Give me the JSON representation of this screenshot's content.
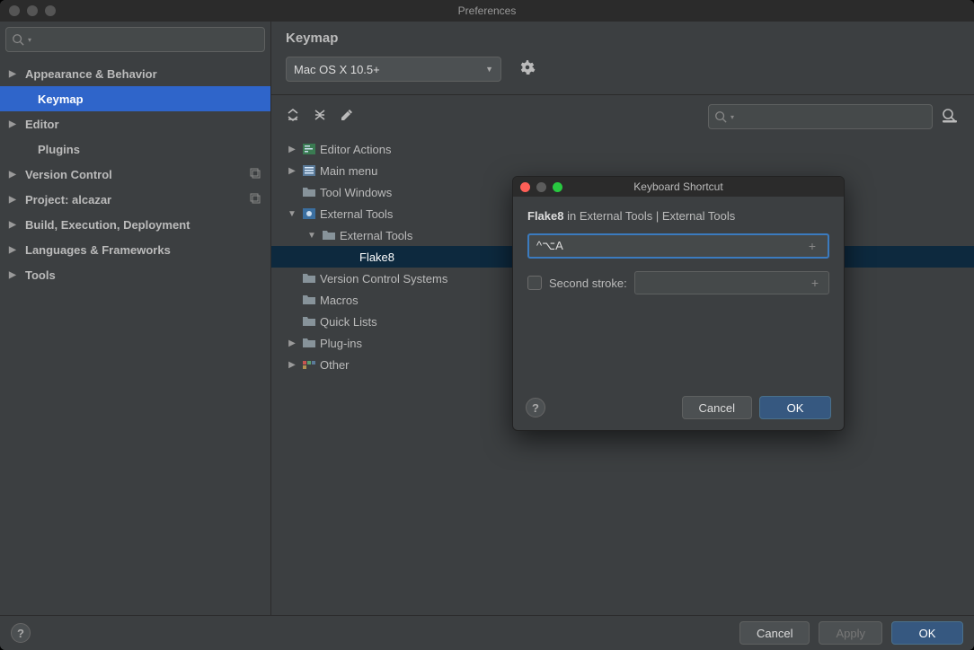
{
  "window_title": "Preferences",
  "sidebar": {
    "items": [
      {
        "label": "Appearance & Behavior",
        "expandable": true
      },
      {
        "label": "Keymap",
        "selected": true,
        "indent": true
      },
      {
        "label": "Editor",
        "expandable": true
      },
      {
        "label": "Plugins",
        "indent": true
      },
      {
        "label": "Version Control",
        "expandable": true,
        "copy": true
      },
      {
        "label": "Project: alcazar",
        "expandable": true,
        "copy": true
      },
      {
        "label": "Build, Execution, Deployment",
        "expandable": true
      },
      {
        "label": "Languages & Frameworks",
        "expandable": true
      },
      {
        "label": "Tools",
        "expandable": true
      }
    ]
  },
  "main": {
    "title": "Keymap",
    "scheme": "Mac OS X 10.5+",
    "tree": [
      {
        "label": "Editor Actions",
        "depth": 0,
        "arrow": "right",
        "icon": "editor"
      },
      {
        "label": "Main menu",
        "depth": 0,
        "arrow": "right",
        "icon": "menu"
      },
      {
        "label": "Tool Windows",
        "depth": 0,
        "arrow": "",
        "icon": "folder"
      },
      {
        "label": "External Tools",
        "depth": 0,
        "arrow": "down",
        "icon": "ext"
      },
      {
        "label": "External Tools",
        "depth": 1,
        "arrow": "down",
        "icon": "folder"
      },
      {
        "label": "Flake8",
        "depth": 2,
        "arrow": "",
        "icon": "",
        "selected": true
      },
      {
        "label": "Version Control Systems",
        "depth": 0,
        "arrow": "",
        "icon": "folder"
      },
      {
        "label": "Macros",
        "depth": 0,
        "arrow": "",
        "icon": "folder"
      },
      {
        "label": "Quick Lists",
        "depth": 0,
        "arrow": "",
        "icon": "folder"
      },
      {
        "label": "Plug-ins",
        "depth": 0,
        "arrow": "right",
        "icon": "folder"
      },
      {
        "label": "Other",
        "depth": 0,
        "arrow": "right",
        "icon": "other"
      }
    ]
  },
  "dialog": {
    "title": "Keyboard Shortcut",
    "context_bold": "Flake8",
    "context_rest": " in External Tools | External Tools",
    "shortcut_value": "^⌥A",
    "second_stroke_label": "Second stroke:",
    "cancel": "Cancel",
    "ok": "OK"
  },
  "footer": {
    "cancel": "Cancel",
    "apply": "Apply",
    "ok": "OK"
  }
}
